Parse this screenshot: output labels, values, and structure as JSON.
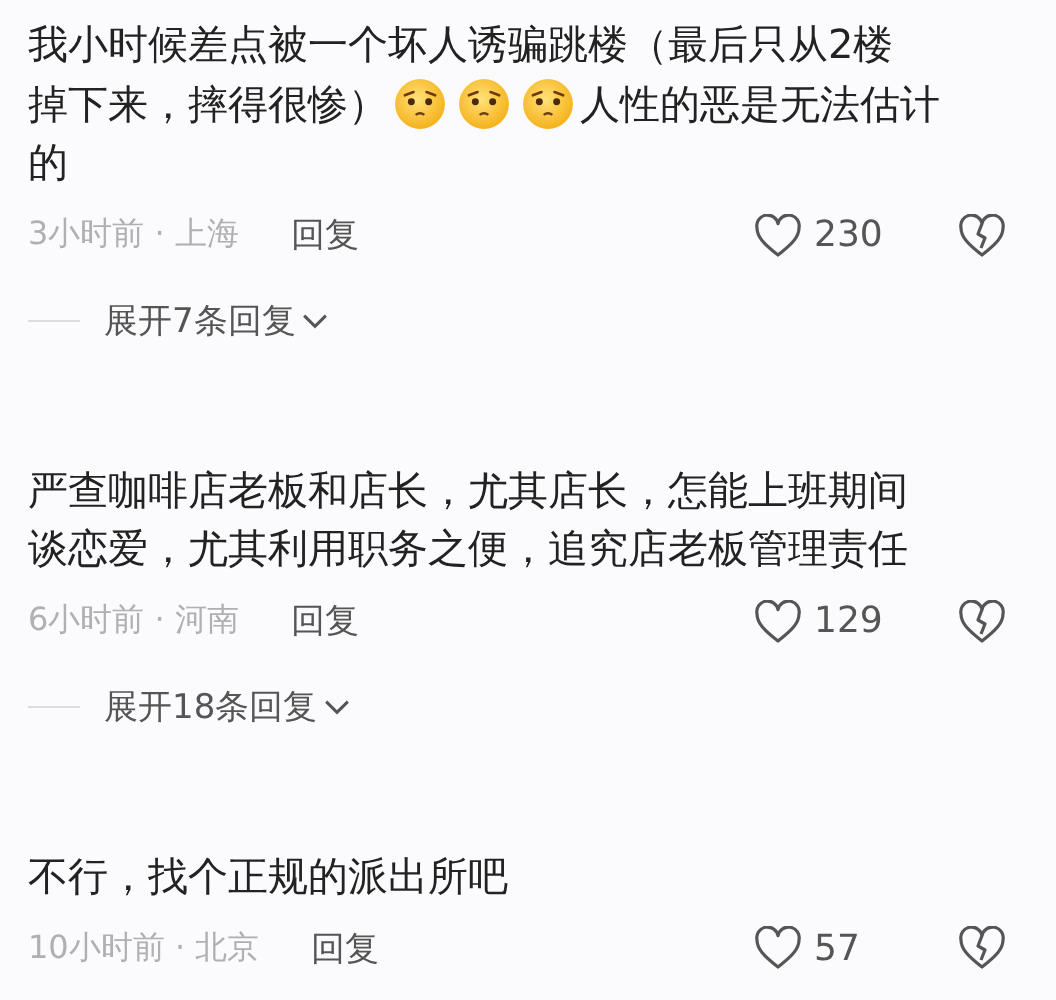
{
  "comments": [
    {
      "lines": [
        [
          {
            "kind": "text",
            "text": "我小时候差点被一个坏人诱骗跳楼（最后只从2楼"
          }
        ],
        [
          {
            "kind": "text",
            "text": "掉下来，摔得很惨）"
          },
          {
            "kind": "emoji"
          },
          {
            "kind": "emoji"
          },
          {
            "kind": "emoji"
          },
          {
            "kind": "text",
            "text": "人性的恶是无法估计"
          }
        ],
        [
          {
            "kind": "text",
            "text": "的"
          }
        ]
      ],
      "time": "3小时前 · 上海",
      "reply": "回复",
      "likes": "230",
      "expand": "展开7条回复"
    },
    {
      "lines": [
        [
          {
            "kind": "text",
            "text": "严查咖啡店老板和店长，尤其店长，怎能上班期间"
          }
        ],
        [
          {
            "kind": "text",
            "text": "谈恋爱，尤其利用职务之便，追究店老板管理责任"
          }
        ]
      ],
      "time": "6小时前 · 河南",
      "reply": "回复",
      "likes": "129",
      "expand": "展开18条回复"
    },
    {
      "lines": [
        [
          {
            "kind": "text",
            "text": "不行，找个正规的派出所吧"
          }
        ]
      ],
      "time": "10小时前 · 北京",
      "reply": "回复",
      "likes": "57"
    }
  ]
}
